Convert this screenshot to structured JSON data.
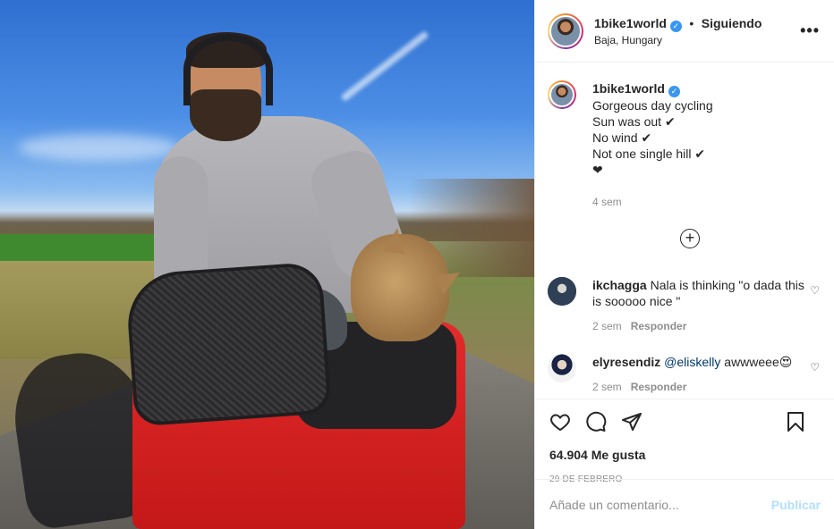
{
  "post": {
    "image_alt": "Man cycling with cat in red bike bag",
    "header": {
      "username": "1bike1world",
      "separator": "•",
      "follow_status": "Siguiendo",
      "location": "Baja, Hungary",
      "more_label": "•••"
    },
    "caption": {
      "username": "1bike1world",
      "lines": [
        "Gorgeous day cycling",
        "Sun was out ✔",
        "No wind ✔",
        "Not one single hill ✔",
        "❤"
      ],
      "age": "4 sem"
    },
    "load_more_symbol": "+",
    "comments": [
      {
        "username": "ikchagga",
        "text": "Nala is thinking \"o dada this is sooooo nice \"",
        "age": "2 sem",
        "reply_label": "Responder"
      },
      {
        "username": "elyresendiz",
        "mention": "@eliskelly",
        "text": " awwweee😍",
        "age": "2 sem",
        "reply_label": "Responder"
      }
    ],
    "likes": "64.904 Me gusta",
    "date": "29 DE FEBRERO",
    "add_comment": {
      "placeholder": "Añade un comentario...",
      "publish_label": "Publicar"
    }
  },
  "icons": {
    "verified": "verified-badge-icon",
    "like": "heart-icon",
    "comment": "comment-bubble-icon",
    "share": "paper-plane-icon",
    "save": "bookmark-icon"
  },
  "colors": {
    "verified": "#3897f0",
    "text": "#262626",
    "muted": "#8e8e8e",
    "publish_disabled": "#b2dffc",
    "mention": "#00376b"
  }
}
